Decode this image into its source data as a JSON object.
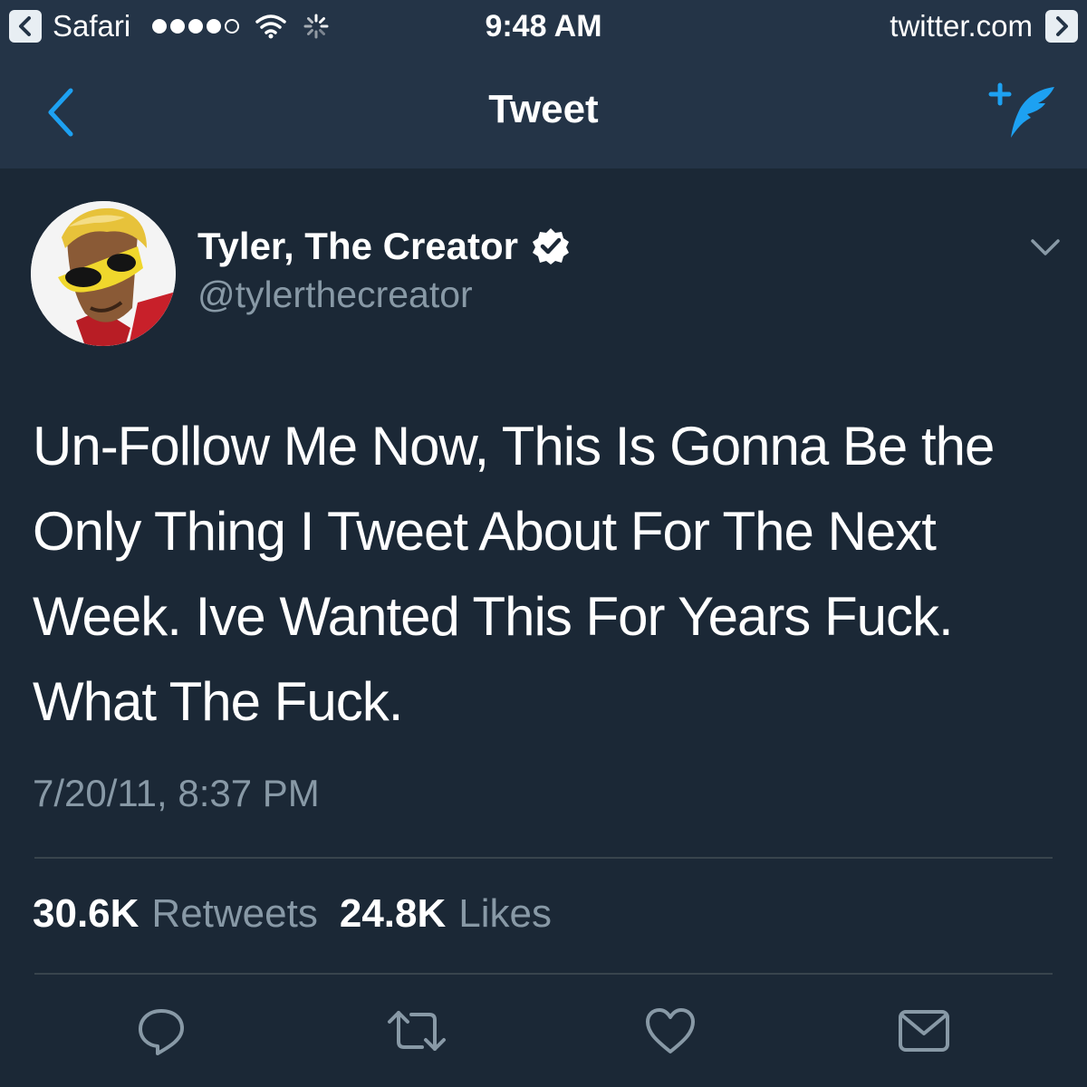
{
  "status_bar": {
    "back_app": "Safari",
    "time": "9:48 AM",
    "site": "twitter.com"
  },
  "nav": {
    "title": "Tweet",
    "icons": [
      "back-chevron-icon",
      "compose-tweet-icon"
    ]
  },
  "tweet": {
    "display_name": "Tyler, The Creator",
    "handle": "@tylerthecreator",
    "verified": true,
    "text": "Un-Follow Me Now, This Is Gonna Be the Only Thing I Tweet About For The Next Week. Ive Wanted This For Years Fuck. What The Fuck.",
    "timestamp": "7/20/11, 8:37 PM",
    "retweets_count": "30.6K",
    "retweets_label": "Retweets",
    "likes_count": "24.8K",
    "likes_label": "Likes"
  },
  "actions": [
    "reply-icon",
    "retweet-icon",
    "like-icon",
    "message-icon"
  ],
  "colors": {
    "background": "#1b2836",
    "header": "#243447",
    "accent": "#1da1f2",
    "muted": "#8899a6"
  }
}
